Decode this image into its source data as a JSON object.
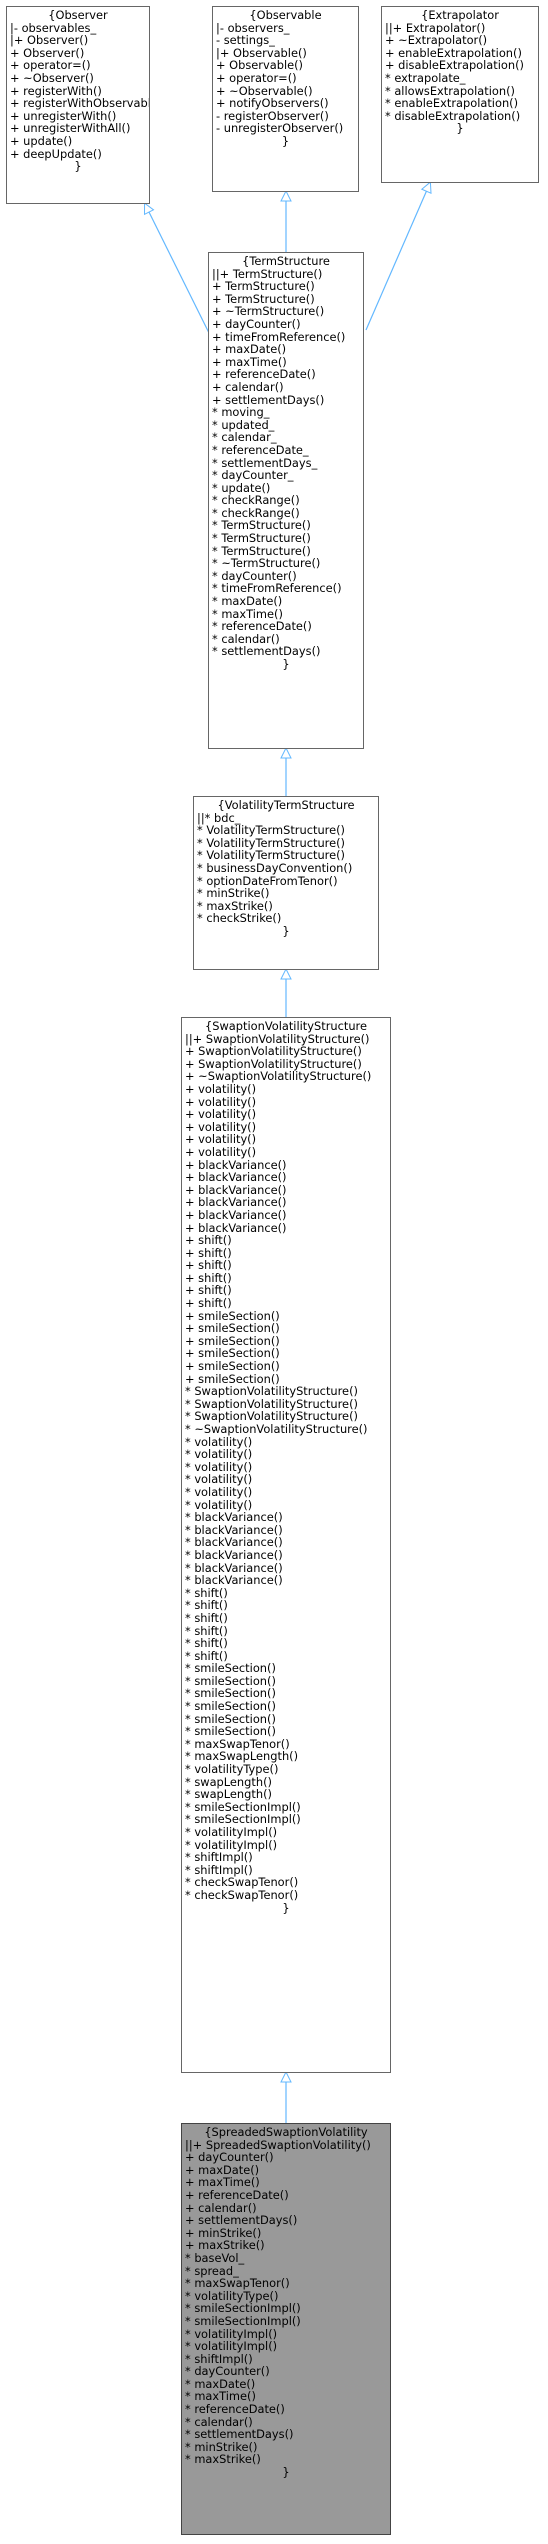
{
  "colors": {
    "edge": "#63b8ff",
    "border": "#666666",
    "current_fill": "#999999",
    "fill": "#ffffff"
  },
  "nodes": {
    "observer": {
      "title": "{Observer",
      "lines": [
        "|- observables_",
        "|+ Observer()",
        "+ Observer()",
        "+ operator=()",
        "+ ~Observer()",
        "+ registerWith()",
        "+ registerWithObservables()",
        "+ unregisterWith()",
        "+ unregisterWithAll()",
        "+ update()",
        "+ deepUpdate()"
      ],
      "tail": "}"
    },
    "observable": {
      "title": "{Observable",
      "lines": [
        "|- observers_",
        "- settings_",
        "|+ Observable()",
        "+ Observable()",
        "+ operator=()",
        "+ ~Observable()",
        "+ notifyObservers()",
        "- registerObserver()",
        "- unregisterObserver()"
      ],
      "tail": "}"
    },
    "extrapolator": {
      "title": "{Extrapolator",
      "lines": [
        "||+ Extrapolator()",
        "+ ~Extrapolator()",
        "+ enableExtrapolation()",
        "+ disableExtrapolation()",
        "* extrapolate_",
        "* allowsExtrapolation()",
        "* enableExtrapolation()",
        "* disableExtrapolation()"
      ],
      "tail": "}"
    },
    "termstructure": {
      "title": "{TermStructure",
      "lines": [
        "||+ TermStructure()",
        "+ TermStructure()",
        "+ TermStructure()",
        "+ ~TermStructure()",
        "+ dayCounter()",
        "+ timeFromReference()",
        "+ maxDate()",
        "+ maxTime()",
        "+ referenceDate()",
        "+ calendar()",
        "+ settlementDays()",
        "* moving_",
        "* updated_",
        "* calendar_",
        "* referenceDate_",
        "* settlementDays_",
        "* dayCounter_",
        "* update()",
        "* checkRange()",
        "* checkRange()",
        "* TermStructure()",
        "* TermStructure()",
        "* TermStructure()",
        "* ~TermStructure()",
        "* dayCounter()",
        "* timeFromReference()",
        "* maxDate()",
        "* maxTime()",
        "* referenceDate()",
        "* calendar()",
        "* settlementDays()"
      ],
      "tail": "}"
    },
    "voltermstructure": {
      "title": "{VolatilityTermStructure",
      "lines": [
        "||* bdc_",
        "* VolatilityTermStructure()",
        "* VolatilityTermStructure()",
        "* VolatilityTermStructure()",
        "* businessDayConvention()",
        "* optionDateFromTenor()",
        "* minStrike()",
        "* maxStrike()",
        "* checkStrike()"
      ],
      "tail": "}"
    },
    "swaptionvol": {
      "title": "{SwaptionVolatilityStructure",
      "lines": [
        "||+ SwaptionVolatilityStructure()",
        "+ SwaptionVolatilityStructure()",
        "+ SwaptionVolatilityStructure()",
        "+ ~SwaptionVolatilityStructure()",
        "+ volatility()",
        "+ volatility()",
        "+ volatility()",
        "+ volatility()",
        "+ volatility()",
        "+ volatility()",
        "+ blackVariance()",
        "+ blackVariance()",
        "+ blackVariance()",
        "+ blackVariance()",
        "+ blackVariance()",
        "+ blackVariance()",
        "+ shift()",
        "+ shift()",
        "+ shift()",
        "+ shift()",
        "+ shift()",
        "+ shift()",
        "+ smileSection()",
        "+ smileSection()",
        "+ smileSection()",
        "+ smileSection()",
        "+ smileSection()",
        "+ smileSection()",
        "* SwaptionVolatilityStructure()",
        "* SwaptionVolatilityStructure()",
        "* SwaptionVolatilityStructure()",
        "* ~SwaptionVolatilityStructure()",
        "* volatility()",
        "* volatility()",
        "* volatility()",
        "* volatility()",
        "* volatility()",
        "* volatility()",
        "* blackVariance()",
        "* blackVariance()",
        "* blackVariance()",
        "* blackVariance()",
        "* blackVariance()",
        "* blackVariance()",
        "* shift()",
        "* shift()",
        "* shift()",
        "* shift()",
        "* shift()",
        "* shift()",
        "* smileSection()",
        "* smileSection()",
        "* smileSection()",
        "* smileSection()",
        "* smileSection()",
        "* smileSection()",
        "* maxSwapTenor()",
        "* maxSwapLength()",
        "* volatilityType()",
        "* swapLength()",
        "* swapLength()",
        "* smileSectionImpl()",
        "* smileSectionImpl()",
        "* volatilityImpl()",
        "* volatilityImpl()",
        "* shiftImpl()",
        "* shiftImpl()",
        "* checkSwapTenor()",
        "* checkSwapTenor()"
      ],
      "tail": "}"
    },
    "spreaded": {
      "title": "{SpreadedSwaptionVolatility",
      "lines": [
        "||+ SpreadedSwaptionVolatility()",
        "+ dayCounter()",
        "+ maxDate()",
        "+ maxTime()",
        "+ referenceDate()",
        "+ calendar()",
        "+ settlementDays()",
        "+ minStrike()",
        "+ maxStrike()",
        "* baseVol_",
        "* spread_",
        "* maxSwapTenor()",
        "* volatilityType()",
        "* smileSectionImpl()",
        "* smileSectionImpl()",
        "* volatilityImpl()",
        "* volatilityImpl()",
        "* shiftImpl()",
        "* dayCounter()",
        "* maxDate()",
        "* maxTime()",
        "* referenceDate()",
        "* calendar()",
        "* settlementDays()",
        "* minStrike()",
        "* maxStrike()"
      ],
      "tail": "}"
    }
  }
}
